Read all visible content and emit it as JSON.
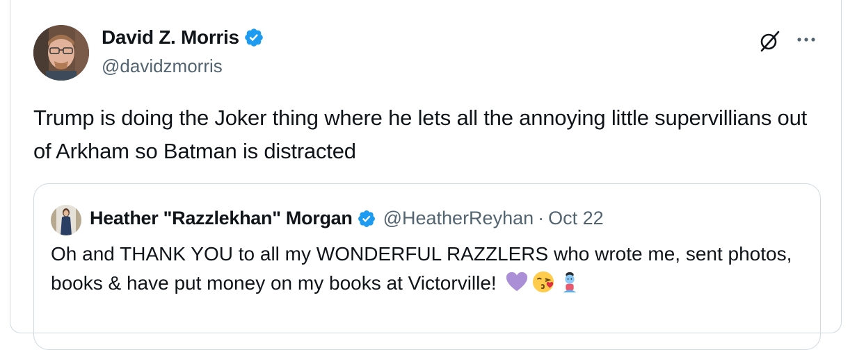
{
  "tweet": {
    "author": {
      "display_name": "David Z. Morris",
      "handle": "@davidzmorris",
      "verified": true
    },
    "text": "Trump is doing the Joker thing where he lets all the annoying little supervillians out of Arkham so Batman is distracted",
    "actions": {
      "grok_icon": "grok-icon",
      "more_icon": "more-icon"
    }
  },
  "quoted_tweet": {
    "author": {
      "display_name": "Heather \"Razzlekhan\" Morgan",
      "handle": "@HeatherReyhan",
      "verified": true
    },
    "separator": "·",
    "date": "Oct 22",
    "text": "Oh and THANK YOU to all my WONDERFUL RAZZLERS who wrote me, sent photos, books & have put money on my books at Victorville!",
    "emojis": [
      "purple-heart-icon",
      "face-blowing-kiss-icon",
      "genie-icon"
    ]
  },
  "colors": {
    "verified_blue": "#1d9bf0",
    "secondary_text": "#536471",
    "border": "#cfd9de"
  }
}
